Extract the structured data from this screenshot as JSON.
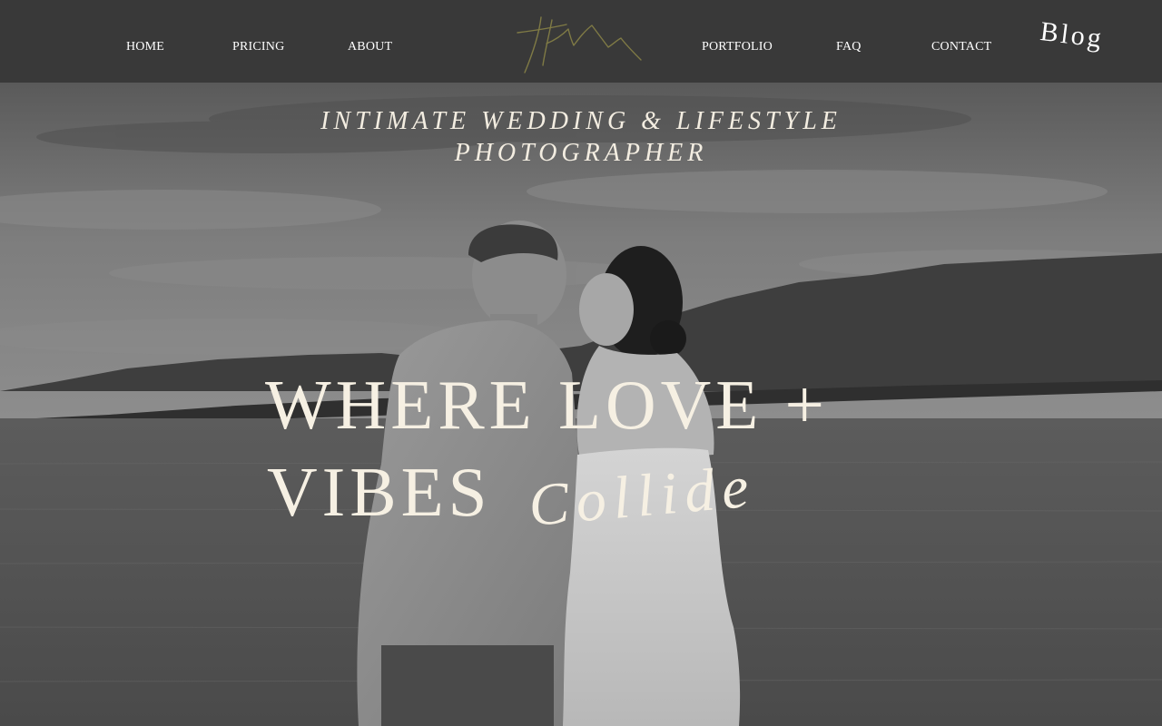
{
  "nav": {
    "left": [
      {
        "label": "HOME"
      },
      {
        "label": "PRICING"
      },
      {
        "label": "ABOUT"
      }
    ],
    "right": [
      {
        "label": "PORTFOLIO"
      },
      {
        "label": "FAQ"
      },
      {
        "label": "CONTACT"
      }
    ],
    "blog_label": "Blog"
  },
  "hero": {
    "kicker_line1": "INTIMATE WEDDING & LIFESTYLE",
    "kicker_line2": "PHOTOGRAPHER",
    "headline_line1": "WHERE LOVE +",
    "headline_line2": "VIBES",
    "headline_script": "Collide"
  },
  "colors": {
    "header_bg": "#393939",
    "nav_text": "#ffffff",
    "hero_text": "#f6f0e3",
    "logo_stroke": "#7f7a45"
  },
  "icons": {
    "logo": "signature-mountain-logo"
  }
}
